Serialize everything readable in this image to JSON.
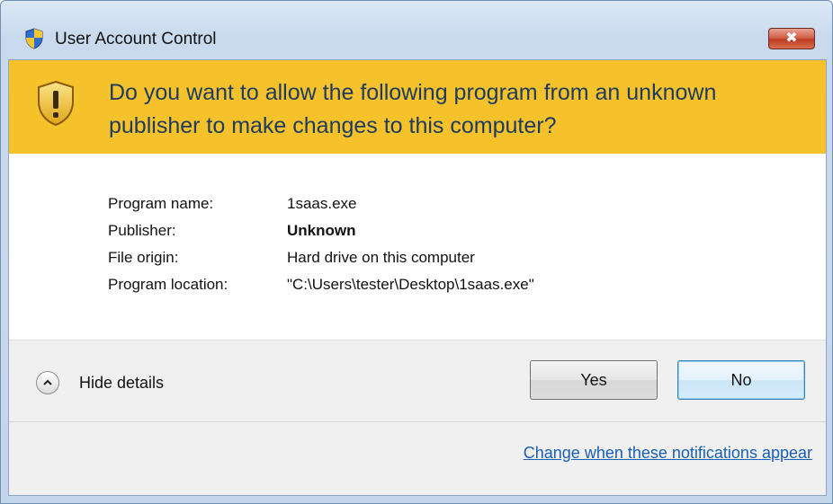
{
  "window": {
    "title": "User Account Control",
    "close_label": "✖",
    "colors": {
      "banner": "#f5c22b",
      "link": "#1a5fb4",
      "close_button": "#c0391f"
    }
  },
  "banner": {
    "question": "Do you want to allow the following program from an unknown publisher to make changes to this computer?",
    "icon": "warning-shield-icon"
  },
  "details": [
    {
      "label": "Program name:",
      "value": "1saas.exe",
      "bold": false
    },
    {
      "label": "Publisher:",
      "value": "Unknown",
      "bold": true
    },
    {
      "label": "File origin:",
      "value": "Hard drive on this computer",
      "bold": false
    },
    {
      "label": "Program location:",
      "value": "\"C:\\Users\\tester\\Desktop\\1saas.exe\"",
      "bold": false
    }
  ],
  "footer": {
    "toggle_label": "Hide details",
    "toggle_icon": "chevron-up-icon",
    "yes_label": "Yes",
    "no_label": "No",
    "link_label": "Change when these notifications appear"
  }
}
